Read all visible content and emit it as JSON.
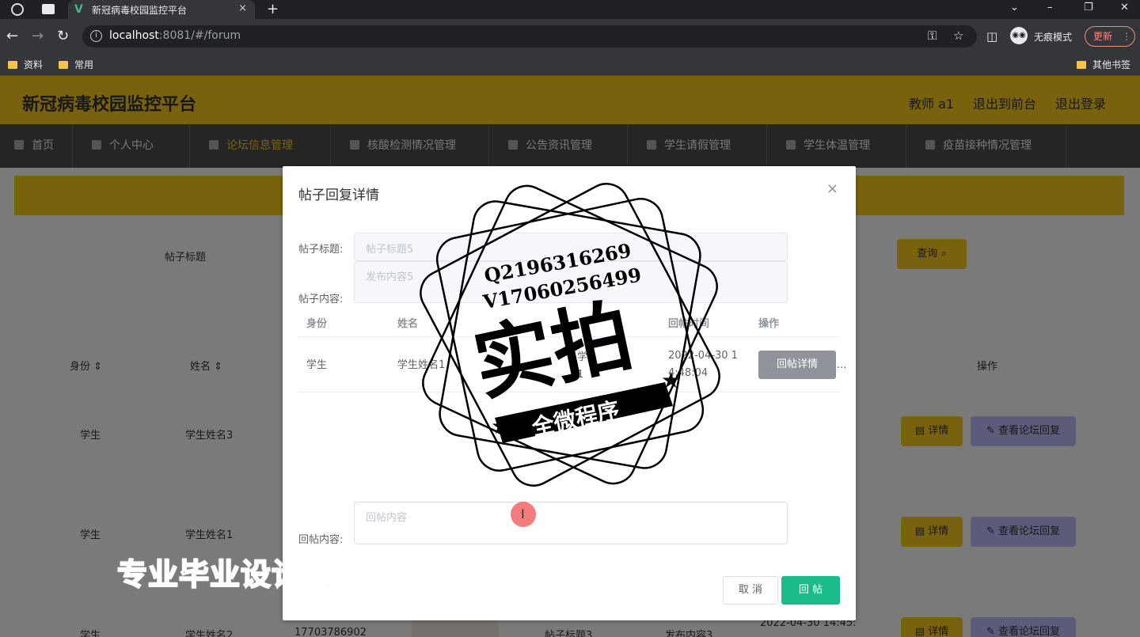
{
  "browser": {
    "tab_title": "新冠病毒校园监控平台",
    "tab_logo": "V",
    "tab_close": "×",
    "new_tab": "+",
    "url_host": "localhost",
    "url_rest": ":8081/#/forum",
    "incognito_label": "无痕模式",
    "update_label": "更新",
    "bookmarks": [
      "资料",
      "常用"
    ],
    "other_bookmarks": "其他书签"
  },
  "app": {
    "title": "新冠病毒校园监控平台",
    "user_label": "教师 a1",
    "to_front": "退出到前台",
    "logout": "退出登录",
    "menu": [
      "首页",
      "个人中心",
      "论坛信息管理",
      "核酸检测情况管理",
      "公告资讯管理",
      "学生请假管理",
      "学生体温管理",
      "疫苗接种情况管理"
    ],
    "active_menu_index": 2,
    "search_label": "帖子标题",
    "search_button": "查询",
    "table_headers": [
      "身份",
      "姓名",
      "操作"
    ],
    "rows": [
      {
        "role": "学生",
        "name": "学生姓名3"
      },
      {
        "role": "学生",
        "name": "学生姓名1"
      },
      {
        "role": "学生",
        "name": "学生姓名2",
        "phone": "17703786902",
        "title": "帖子标题3",
        "content": "发布内容3",
        "time": "2022-04-30 14:45:"
      }
    ],
    "detail_button": "详情",
    "view_reply_button": "查看论坛回复"
  },
  "dialog": {
    "title": "帖子回复详情",
    "close": "×",
    "post_title_label": "帖子标题:",
    "post_title_value": "帖子标题5",
    "post_content_label": "帖子内容:",
    "post_content_value": "发布内容5",
    "reply_table_headers": [
      "身份",
      "姓名",
      "回帖时间",
      "操作"
    ],
    "reply_row": {
      "role": "学生",
      "name": "学生姓名1",
      "content": "学",
      "content_line2": "1",
      "time": "2022-04-30 1",
      "time_line2": "4:48:04",
      "overflow": "..."
    },
    "reply_detail_button": "回帖详情",
    "reply_label": "回帖内容:",
    "reply_placeholder": "回帖内容",
    "cancel_button": "取 消",
    "submit_button": "回 帖"
  },
  "watermark": {
    "qq": "Q2196316269",
    "vx": "V17060256499",
    "big": "实拍",
    "ribbon": "全微程序",
    "bottom": "专业毕业设计代做"
  },
  "colors": {
    "brand_yellow": "#f2c41c",
    "menu_bg": "#4a4a4a",
    "submit_green": "#1abc8c",
    "reply_purple": "#b7b9f5"
  }
}
